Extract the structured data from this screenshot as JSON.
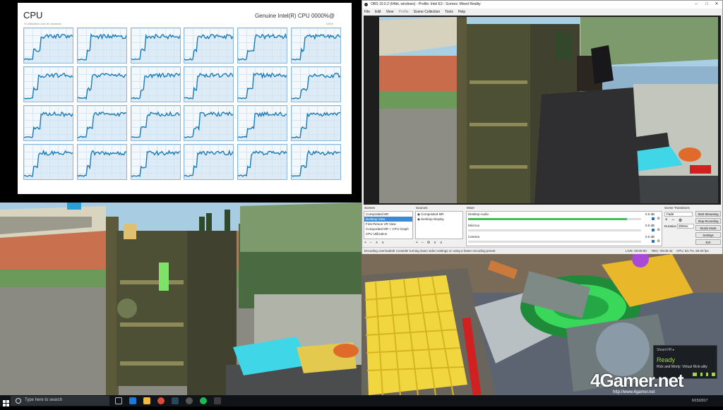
{
  "cpu_panel": {
    "title": "CPU",
    "processor_name": "Genuine Intel(R) CPU 0000%@",
    "subtitle": "% Utilization over 60 seconds",
    "max_label": "100%",
    "core_count": 24,
    "line_color": "#1a7bb8"
  },
  "obs": {
    "window_title": "OBS 19.0.2 (64bit, windows) - Profile: Intel E3 - Scenes: Mixed Reality",
    "menu": [
      "File",
      "Edit",
      "View",
      "Profile",
      "Scene Collection",
      "Tools",
      "Help"
    ],
    "scenes_label": "Scenes",
    "scenes": [
      "Composited MR",
      "Desktop View",
      "First Person VR View",
      "Composited MR + CPU Graph",
      "CPU Utilization"
    ],
    "selected_scene": 1,
    "sources_label": "Sources",
    "sources": [
      "Composited MR",
      "Desktop Display"
    ],
    "mixer_label": "Mixer",
    "mixer": [
      {
        "name": "Desktop Audio",
        "level": "0.0 dB",
        "fill": 0.92
      },
      {
        "name": "Mic/Aux",
        "level": "0.0 dB",
        "fill": 0.0
      },
      {
        "name": "Camera",
        "level": "0.0 dB",
        "fill": 0.0
      }
    ],
    "transitions_label": "Scene Transitions",
    "transition": "Fade",
    "duration_label": "Duration",
    "duration": "300ms",
    "controls": [
      "Start Streaming",
      "Stop Recording",
      "Studio Mode",
      "Settings",
      "Exit"
    ],
    "status_message": "Encoding overloaded!  Consider turning down video settings or using a faster encoding preset.",
    "live": "LIVE: 00:00:00",
    "rec": "REC: 00:00:42",
    "cpu_fps": "CPU: 84.7%, 60.00 fps"
  },
  "steamvr": {
    "header": "SteamVR ▸",
    "status": "Ready",
    "app": "Rick and Morty: Virtual Rick-ality"
  },
  "taskbar": {
    "search_placeholder": "Type here to search",
    "time": "",
    "date": "6/15/2017"
  },
  "watermark": {
    "logo": "4Gamer.net",
    "url": "http://www.4gamer.net"
  },
  "colors": {
    "obs_selection": "#3c8ad6",
    "meter_green": "#3fbf4f",
    "steamvr_ready": "#9fd24d",
    "taskbar": "#101419"
  }
}
